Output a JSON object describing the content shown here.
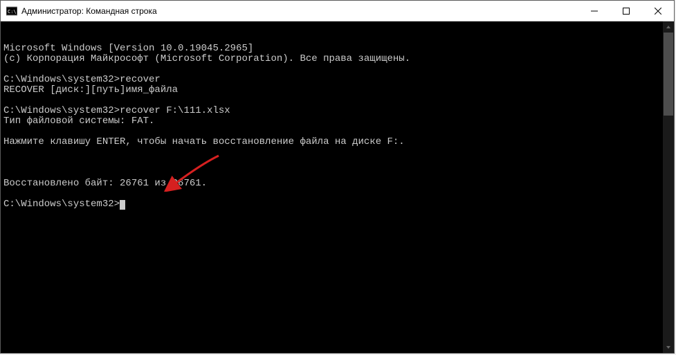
{
  "titlebar": {
    "title": "Администратор: Командная строка"
  },
  "terminal": {
    "lines": [
      "Microsoft Windows [Version 10.0.19045.2965]",
      "(c) Корпорация Майкрософт (Microsoft Corporation). Все права защищены.",
      "",
      "C:\\Windows\\system32>recover",
      "RECOVER [диск:][путь]имя_файла",
      "",
      "C:\\Windows\\system32>recover F:\\111.xlsx",
      "Тип файловой системы: FAT.",
      "",
      "Нажмите клавишу ENTER, чтобы начать восстановление файла на диске F:.",
      "",
      "",
      "",
      "Восстановлено байт: 26761 из 26761.",
      "",
      "C:\\Windows\\system32>"
    ],
    "prompt_index": 15
  },
  "annotation": {
    "arrow_color": "#d62020"
  }
}
